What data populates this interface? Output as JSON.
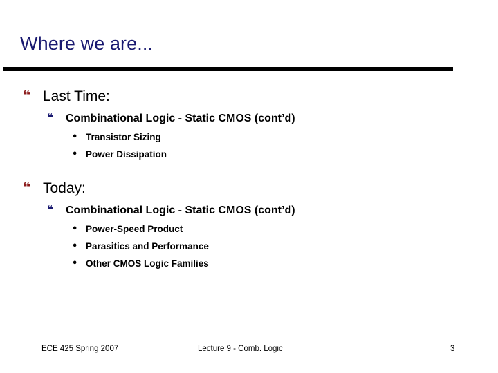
{
  "slide": {
    "title": "Where we are...",
    "page_number": "3",
    "colors": {
      "title": "#191970",
      "rule": "#000000",
      "bullet_level1": "#8B1A1A",
      "bullet_level2": "#191970",
      "bullet_level3": "#000000",
      "body_text": "#000000",
      "background": "#ffffff"
    }
  },
  "icons": {
    "bullet_l1": "❝",
    "bullet_l2": "❝",
    "bullet_l3": "•"
  },
  "content": {
    "groups": [
      {
        "heading": "Last Time:",
        "subheading": "Combinational Logic - Static CMOS (cont’d)",
        "items": [
          "Transistor Sizing",
          "Power Dissipation"
        ]
      },
      {
        "heading": "Today:",
        "subheading": "Combinational Logic - Static CMOS (cont’d)",
        "items": [
          "Power-Speed Product",
          "Parasitics and Performance",
          "Other CMOS Logic Families"
        ]
      }
    ]
  },
  "footer": {
    "course": "ECE 425 Spring 2007",
    "lecture": "Lecture 9 - Comb. Logic",
    "page": "3"
  }
}
